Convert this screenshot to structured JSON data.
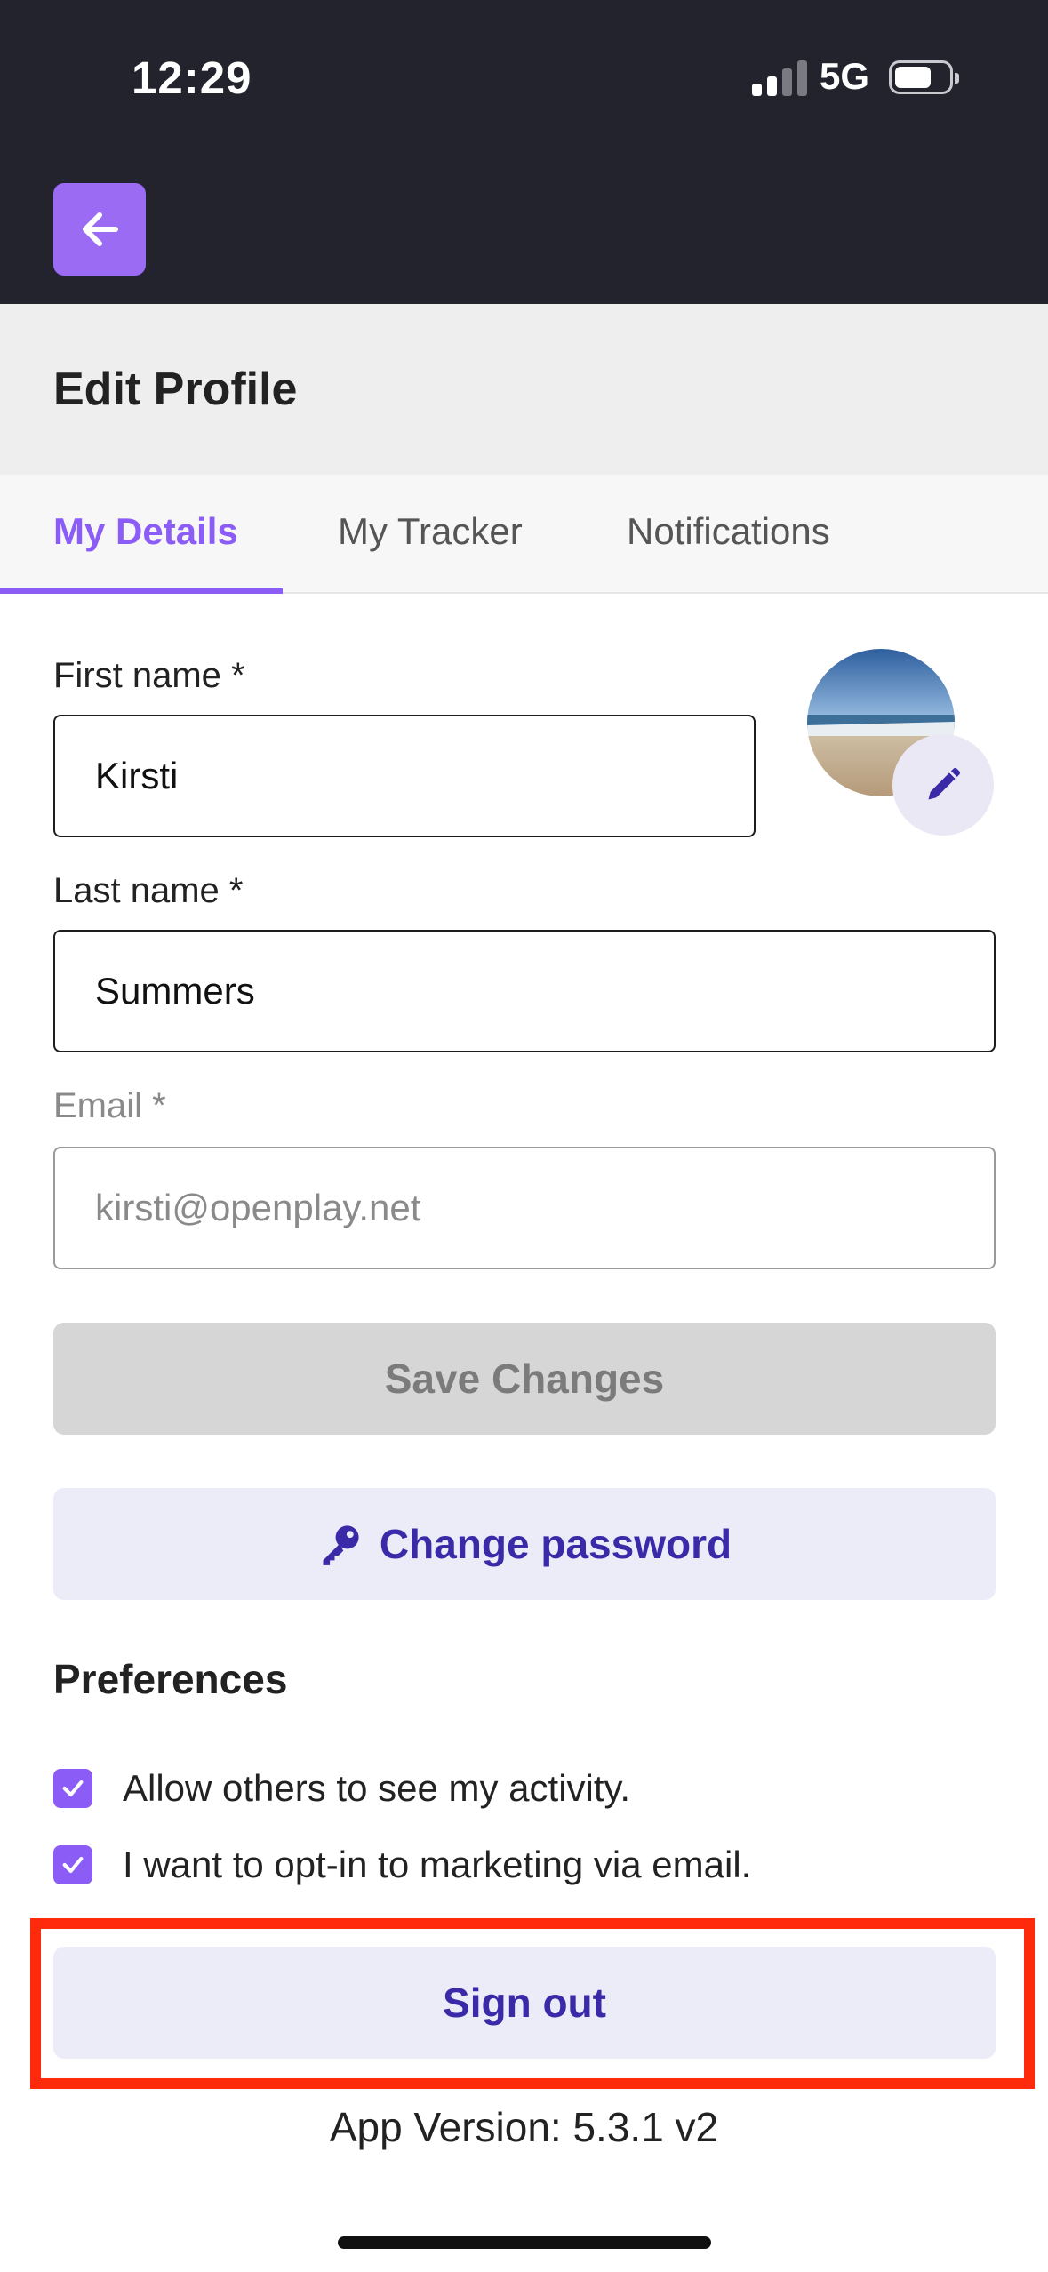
{
  "status": {
    "time": "12:29",
    "network": "5G"
  },
  "header": {
    "title": "Edit Profile"
  },
  "tabs": [
    {
      "label": "My Details",
      "active": true
    },
    {
      "label": "My Tracker",
      "active": false
    },
    {
      "label": "Notifications",
      "active": false
    }
  ],
  "form": {
    "first_name": {
      "label": "First name *",
      "value": "Kirsti"
    },
    "last_name": {
      "label": "Last name *",
      "value": "Summers"
    },
    "email": {
      "label": "Email *",
      "value": "kirsti@openplay.net"
    }
  },
  "buttons": {
    "save": "Save Changes",
    "change_password": "Change password",
    "sign_out": "Sign out"
  },
  "preferences": {
    "title": "Preferences",
    "items": [
      {
        "label": "Allow others to see my activity.",
        "checked": true
      },
      {
        "label": "I want to opt-in to marketing via email.",
        "checked": true
      }
    ]
  },
  "footer": {
    "version": "App Version: 5.3.1 v2"
  },
  "colors": {
    "accent": "#8b5cf6",
    "primary_text": "#3b2aa8",
    "highlight": "#ff2a0c",
    "header_bg": "#23232e"
  }
}
